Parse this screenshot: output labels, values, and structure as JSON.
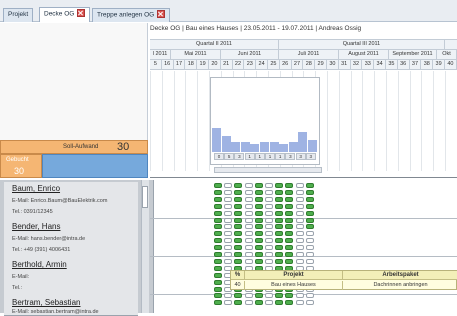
{
  "tabs": [
    {
      "label": "Projekt",
      "closable": false,
      "active": false
    },
    {
      "label": "Decke OG",
      "closable": true,
      "active": true
    },
    {
      "label": "Treppe anlegen OG",
      "closable": true,
      "active": false
    }
  ],
  "timeline": {
    "title": "Decke OG | Bau eines Hauses | 23.05.2011 - 19.07.2011 | Andreas Ossig",
    "quarters": [
      "Quartal II 2011",
      "Quartal III 2011"
    ],
    "months": [
      "l 2011",
      "Mai 2011",
      "Juni 2011",
      "Juli 2011",
      "August 2011",
      "September 2011",
      "Okt"
    ],
    "weeks": [
      "5",
      "16",
      "17",
      "18",
      "19",
      "20",
      "21",
      "22",
      "23",
      "24",
      "25",
      "26",
      "27",
      "28",
      "29",
      "30",
      "31",
      "32",
      "33",
      "34",
      "35",
      "36",
      "37",
      "38",
      "39",
      "40"
    ]
  },
  "histogram": {
    "bar_levels": [
      0.3,
      0.2,
      0.12,
      0.12,
      0.1,
      0.12,
      0.12,
      0.1,
      0.12,
      0.25,
      0.15
    ],
    "week_badges": [
      "0",
      "5",
      "3",
      "1",
      "1",
      "1",
      "1",
      "3",
      "3",
      "3"
    ]
  },
  "summary": {
    "soll_label": "Soll-Aufwand",
    "soll_value": "30",
    "gebucht_label": "Gebucht",
    "gebucht_value": "30"
  },
  "people": [
    {
      "name": "Baum, Enrico",
      "email": "E-Mail: Enrico.Baum@BauElektrik.com",
      "tel": "Tel.: 0391/12345"
    },
    {
      "name": "Bender, Hans",
      "email": "E-Mail: hans.bender@intra.de",
      "tel": "Tel.: +49 (391) 4006431"
    },
    {
      "name": "Berthold, Armin",
      "email": "E-Mail:",
      "tel": "Tel.:"
    },
    {
      "name": "Bertram, Sebastian",
      "email": "E-Mail: sebastian.bertram@intra.de",
      "tel": ""
    }
  ],
  "tooltip": {
    "headers": [
      "%",
      "Projekt",
      "Arbeitspaket"
    ],
    "row": [
      "40",
      "Bau eines Hauses",
      "Dachrinnen anbringen"
    ]
  },
  "colors": {
    "accent_orange": "#f5b673",
    "booked_blue": "#76a9dc",
    "slot_green": "#4fae4d"
  }
}
